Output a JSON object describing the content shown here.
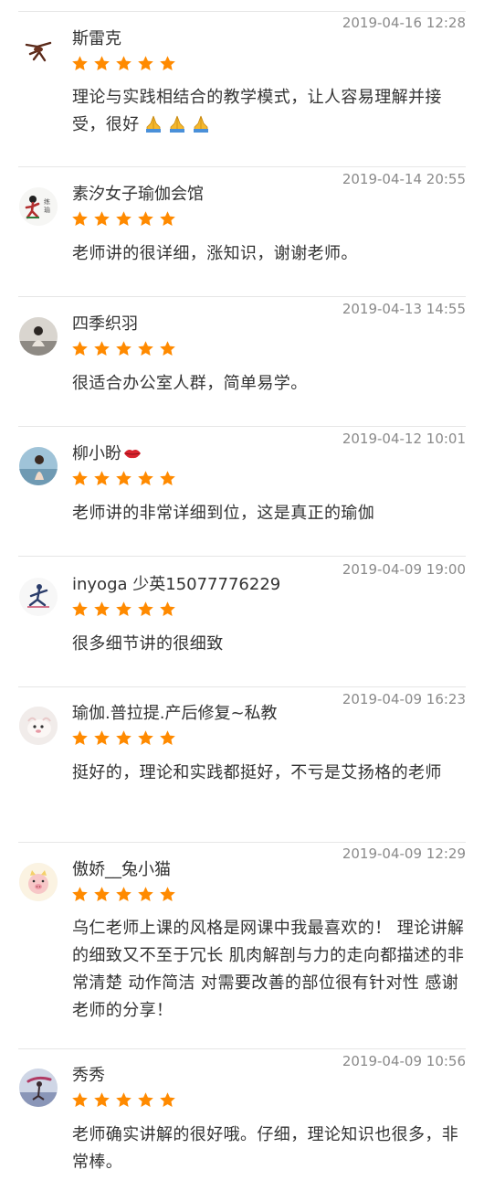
{
  "colors": {
    "star": "#FF8A00",
    "divider": "#E6E6E6",
    "text": "#333333",
    "timestamp": "#8A8A8A"
  },
  "reviews": [
    {
      "username": "斯雷克",
      "timestamp": "2019-04-16 12:28",
      "rating": 5,
      "content": "理论与实践相结合的教学模式，让人容易理解并接受，很好",
      "trailing_icons": [
        "pray-icon",
        "pray-icon",
        "pray-icon"
      ],
      "avatar_icon": "antelope-avatar"
    },
    {
      "username": "素汐女子瑜伽会馆",
      "timestamp": "2019-04-14 20:55",
      "rating": 5,
      "content": "老师讲的很详细，涨知识，谢谢老师。",
      "avatar_icon": "yoga-logo-avatar"
    },
    {
      "username": "四季织羽",
      "timestamp": "2019-04-13 14:55",
      "rating": 5,
      "content": "很适合办公室人群，简单易学。",
      "avatar_icon": "portrait-avatar"
    },
    {
      "username": "柳小盼",
      "timestamp": "2019-04-12 10:01",
      "rating": 5,
      "content": "老师讲的非常详细到位，这是真正的瑜伽",
      "name_icon": "lips-icon",
      "avatar_icon": "beach-avatar"
    },
    {
      "username": "inyoga 少英15077776229",
      "timestamp": "2019-04-09 19:00",
      "rating": 5,
      "content": "很多细节讲的很细致",
      "avatar_icon": "yoga-pose-avatar"
    },
    {
      "username": "瑜伽.普拉提.产后修复~私教",
      "timestamp": "2019-04-09 16:23",
      "rating": 5,
      "content": "挺好的，理论和实践都挺好，不亏是艾扬格的老师",
      "avatar_icon": "pet-avatar"
    },
    {
      "username": "傲娇__兔小猫",
      "timestamp": "2019-04-09 12:29",
      "rating": 5,
      "content": "乌仁老师上课的风格是网课中我最喜欢的！ 理论讲解的细致又不至于冗长 肌肉解剖与力的走向都描述的非常清楚 动作简洁 对需要改善的部位很有针对性 感谢老师的分享！",
      "avatar_icon": "pig-avatar"
    },
    {
      "username": "秀秀",
      "timestamp": "2019-04-09 10:56",
      "rating": 5,
      "content": "老师确实讲解的很好哦。仔细，理论知识也很多，非常棒。",
      "avatar_icon": "dancer-avatar"
    }
  ]
}
